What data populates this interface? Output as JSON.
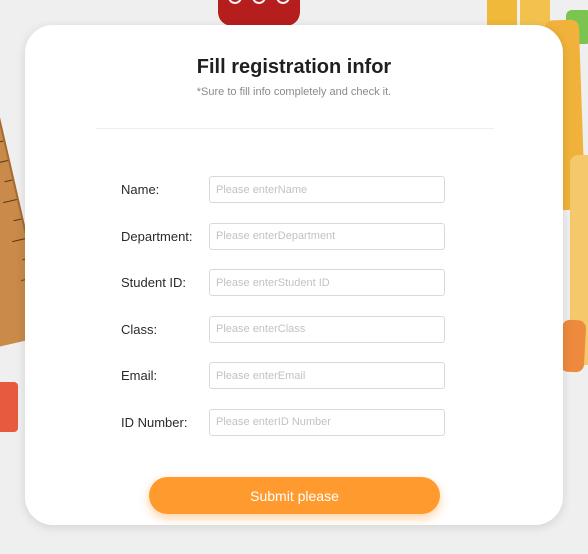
{
  "form": {
    "title": "Fill registration infor",
    "subtitle": "*Sure to fill info completely and check it.",
    "fields": [
      {
        "label": "Name:",
        "placeholder": "Please enterName",
        "value": ""
      },
      {
        "label": "Department:",
        "placeholder": "Please enterDepartment",
        "value": ""
      },
      {
        "label": "Student ID:",
        "placeholder": "Please enterStudent ID",
        "value": ""
      },
      {
        "label": "Class:",
        "placeholder": "Please enterClass",
        "value": ""
      },
      {
        "label": "Email:",
        "placeholder": "Please enterEmail",
        "value": ""
      },
      {
        "label": "ID Number:",
        "placeholder": "Please enterID Number",
        "value": ""
      }
    ],
    "submit_label": "Submit please"
  },
  "colors": {
    "accent": "#ff9a2e",
    "card_background": "#ffffff",
    "page_background": "#efefef"
  }
}
